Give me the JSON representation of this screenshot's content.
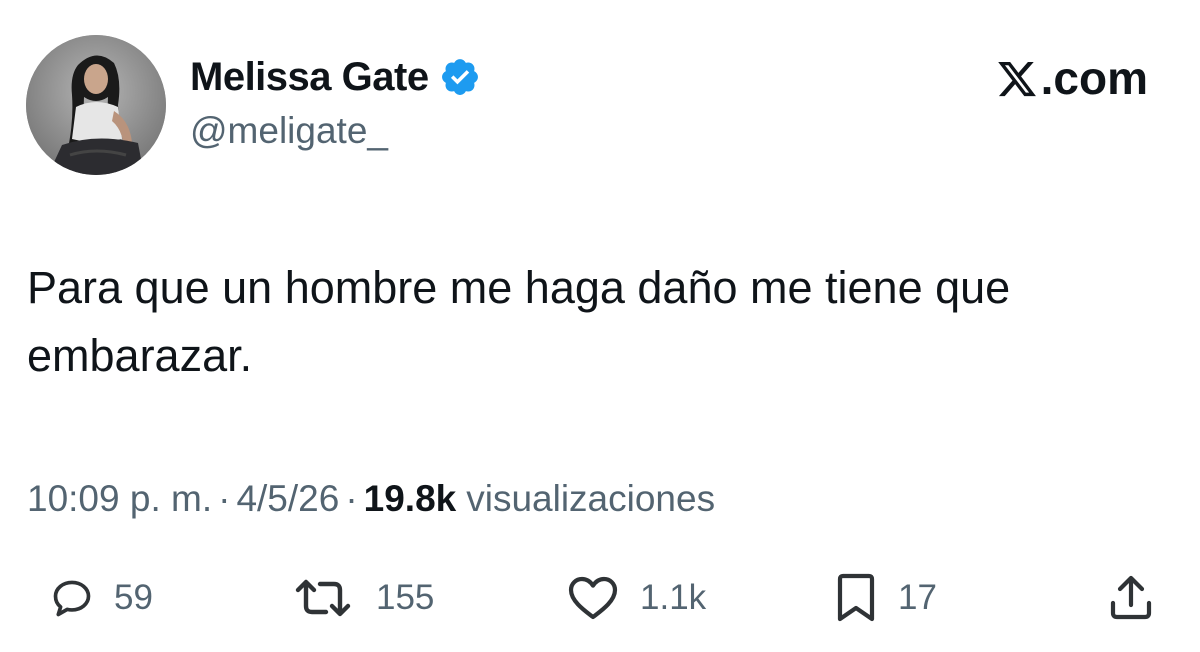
{
  "author": {
    "display_name": "Melissa Gate",
    "handle": "@meligate_",
    "verified": true,
    "avatar_icon": "profile-photo"
  },
  "brand": {
    "suffix": ".com",
    "logo_icon": "x-logo-icon"
  },
  "tweet": {
    "text": "Para que un hombre me haga daño me tiene que embarazar."
  },
  "meta": {
    "time": "10:09 p. m.",
    "date": "4/5/26",
    "separator": "·",
    "views_count": "19.8k",
    "views_label": "visualizaciones"
  },
  "actions": {
    "replies": "59",
    "reposts": "155",
    "likes": "1.1k",
    "bookmarks": "17"
  },
  "colors": {
    "text_primary": "#0f1419",
    "text_secondary": "#536471",
    "verified_blue": "#1d9bf0"
  }
}
